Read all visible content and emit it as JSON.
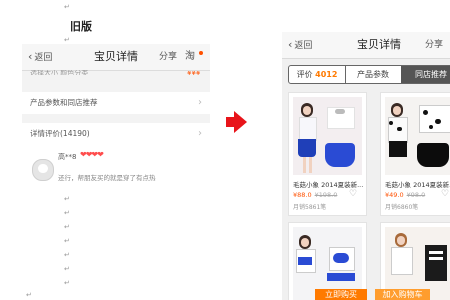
{
  "page": {
    "old_label": "旧版"
  },
  "old_screen": {
    "header": {
      "back_label": "返回",
      "title": "宝贝详情",
      "share_label": "分享",
      "tao_label": "淘"
    },
    "partial_text": "选择大小 颜色分类",
    "partial_right": "¥¥¥",
    "rows": [
      {
        "label": "产品参数和同店推荐",
        "arrow": "›"
      },
      {
        "label": "详情评价(14190)",
        "arrow": "›"
      }
    ],
    "comment": {
      "user": "高**8",
      "hearts": "❤❤❤❤",
      "text": "还行，帮朋友买的就是穿了有点热"
    }
  },
  "new_screen": {
    "header": {
      "back_label": "返回",
      "title": "宝贝详情",
      "share_label": "分享"
    },
    "tabs": [
      {
        "label": "评价",
        "count": "4012"
      },
      {
        "label": "产品参数"
      },
      {
        "label": "同店推荐"
      }
    ],
    "products": [
      {
        "name": "毛菇小象 2014夏装新...",
        "price": "¥88.0",
        "old_price": "¥198.0",
        "sold": "月销5861笔"
      },
      {
        "name": "毛菇小象 2014夏装新...",
        "price": "¥49.0",
        "old_price": "¥98.0",
        "sold": "月销6860笔"
      },
      {
        "name": "",
        "price": "",
        "old_price": "",
        "sold": ""
      },
      {
        "name": "",
        "price": "",
        "old_price": "",
        "sold": ""
      }
    ],
    "buttons": {
      "buy_label": "立即购买",
      "cart_label": "加入购物车"
    }
  },
  "colors": {
    "accent": "#ff5000",
    "arrow": "#e8141a",
    "active_tab": "#555555"
  }
}
